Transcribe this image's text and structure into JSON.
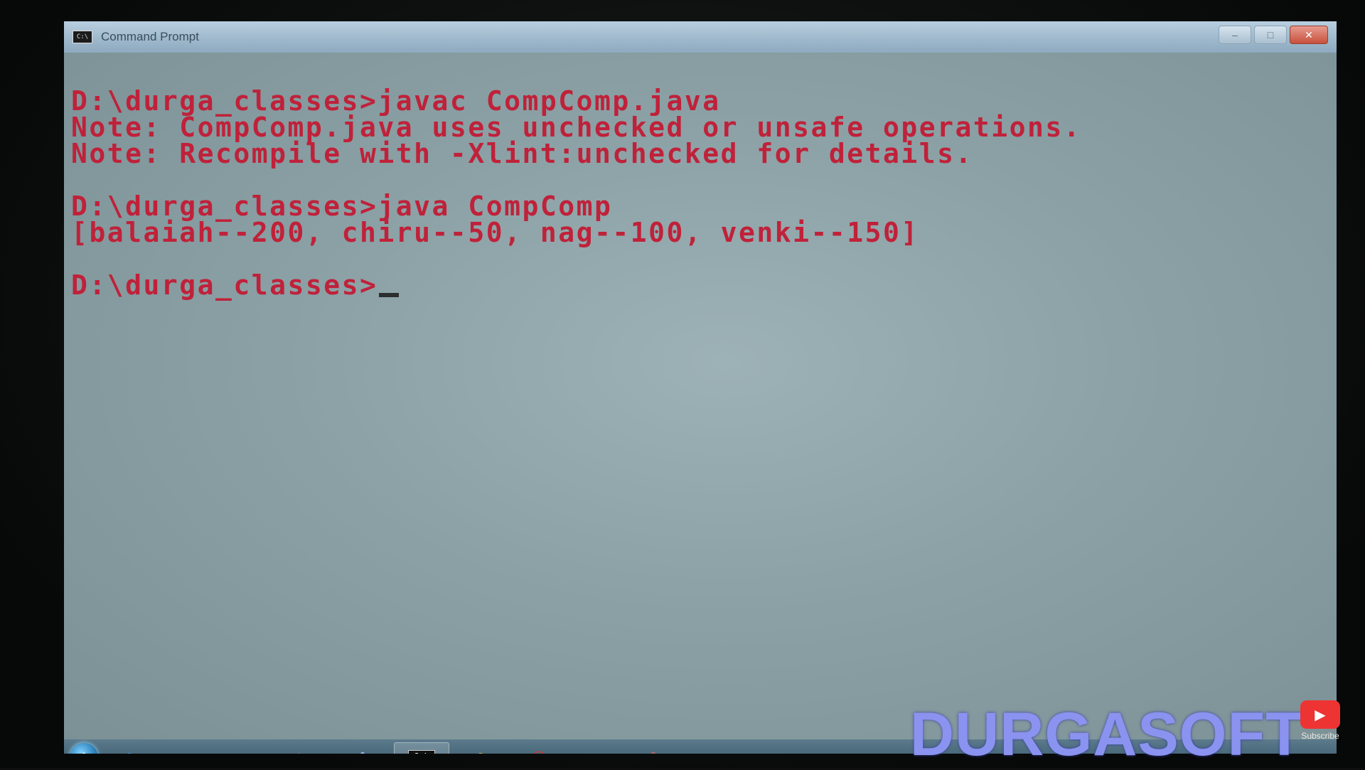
{
  "window": {
    "title": "Command Prompt",
    "icon": "cmd-icon",
    "controls": [
      "minimize-icon",
      "maximize-icon",
      "close-icon"
    ]
  },
  "console": {
    "lines": [
      "D:\\durga_classes>javac CompComp.java",
      "Note: CompComp.java uses unchecked or unsafe operations.",
      "Note: Recompile with -Xlint:unchecked for details.",
      "",
      "D:\\durga_classes>java CompComp",
      "[balaiah--200, chiru--50, nag--100, venki--150]",
      "",
      "D:\\durga_classes>"
    ],
    "text_color": "#c0213a"
  },
  "taskbar": {
    "items": [
      {
        "icon": "internet-explorer-icon",
        "active": false
      },
      {
        "icon": "folder-icon",
        "active": false
      },
      {
        "icon": "powerpoint-icon",
        "active": false
      },
      {
        "icon": "media-player-icon",
        "active": false
      },
      {
        "icon": "paint-icon",
        "active": false
      },
      {
        "icon": "command-prompt-icon",
        "active": true
      },
      {
        "icon": "chrome-icon",
        "active": false
      },
      {
        "icon": "opera-icon",
        "active": false
      },
      {
        "icon": "pie-chart-icon",
        "active": false
      },
      {
        "icon": "editor-icon",
        "active": false
      }
    ]
  },
  "watermark": {
    "brand": "DURGASOFT",
    "subscribe_label": "Subscribe"
  }
}
